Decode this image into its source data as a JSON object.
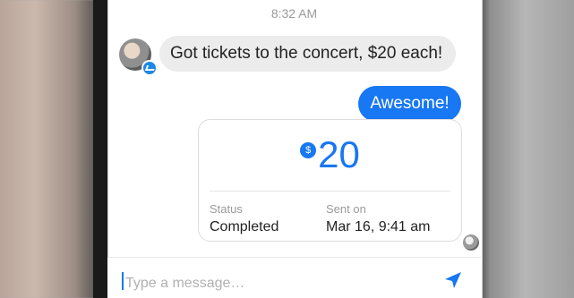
{
  "conversation": {
    "timestamp": "8:32 AM",
    "incoming_message": "Got tickets to the concert, $20 each!",
    "outgoing_message": "Awesome!"
  },
  "payment": {
    "currency_icon": "dollar-icon",
    "currency_symbol": "$",
    "amount": "20",
    "status_label": "Status",
    "status_value": "Completed",
    "sent_label": "Sent on",
    "sent_value": "Mar 16, 9:41 am"
  },
  "composer": {
    "placeholder": "Type a message…",
    "send_icon": "send-arrow-icon"
  },
  "colors": {
    "accent": "#1877f2",
    "incoming_bubble": "#ececec"
  }
}
